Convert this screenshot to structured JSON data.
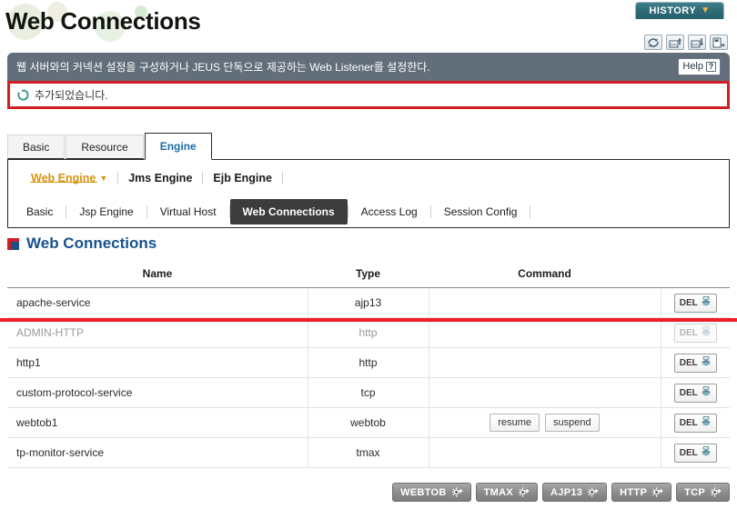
{
  "page": {
    "title": "Web Connections"
  },
  "history_tab": {
    "label": "HISTORY",
    "caret": "chevron-down"
  },
  "top_tools": [
    {
      "name": "refresh-icon",
      "title": "Refresh"
    },
    {
      "name": "xml-upload-icon",
      "title": "XML Upload"
    },
    {
      "name": "xml-download-icon",
      "title": "XML Download"
    },
    {
      "name": "apply-icon",
      "title": "Apply"
    }
  ],
  "banner": {
    "description": "웹 서버와의 커넥션 설정을 구성하거나 JEUS 단독으로 제공하는 Web Listener를 설정한다.",
    "help_label": "Help",
    "help_glyph": "?"
  },
  "message": {
    "text": "추가되었습니다.",
    "icon": "refresh-circle-icon",
    "border_color": "#cf1f24"
  },
  "tabs_level1": [
    {
      "label": "Basic",
      "active": false
    },
    {
      "label": "Resource",
      "active": false
    },
    {
      "label": "Engine",
      "active": true
    }
  ],
  "subnav": [
    {
      "label": "Web Engine",
      "active": true,
      "has_caret": true
    },
    {
      "label": "Jms Engine",
      "active": false,
      "has_caret": false
    },
    {
      "label": "Ejb Engine",
      "active": false,
      "has_caret": false
    }
  ],
  "tabs_level3": [
    {
      "label": "Basic",
      "active": false
    },
    {
      "label": "Jsp Engine",
      "active": false
    },
    {
      "label": "Virtual Host",
      "active": false
    },
    {
      "label": "Web Connections",
      "active": true
    },
    {
      "label": "Access Log",
      "active": false
    },
    {
      "label": "Session Config",
      "active": false
    }
  ],
  "section": {
    "title": "Web Connections"
  },
  "table": {
    "columns": [
      "Name",
      "Type",
      "Command"
    ],
    "action_label": "DEL",
    "rows": [
      {
        "name": "apache-service",
        "type": "ajp13",
        "commands": [],
        "del_enabled": true,
        "disabled": false,
        "highlighted": true
      },
      {
        "name": "ADMIN-HTTP",
        "type": "http",
        "commands": [],
        "del_enabled": false,
        "disabled": true,
        "highlighted": false
      },
      {
        "name": "http1",
        "type": "http",
        "commands": [],
        "del_enabled": true,
        "disabled": false,
        "highlighted": false
      },
      {
        "name": "custom-protocol-service",
        "type": "tcp",
        "commands": [],
        "del_enabled": true,
        "disabled": false,
        "highlighted": false
      },
      {
        "name": "webtob1",
        "type": "webtob",
        "commands": [
          "resume",
          "suspend"
        ],
        "del_enabled": true,
        "disabled": false,
        "highlighted": false
      },
      {
        "name": "tp-monitor-service",
        "type": "tmax",
        "commands": [],
        "del_enabled": true,
        "disabled": false,
        "highlighted": false
      }
    ]
  },
  "bottom_buttons": [
    {
      "label": "WEBTOB"
    },
    {
      "label": "TMAX"
    },
    {
      "label": "AJP13"
    },
    {
      "label": "HTTP"
    },
    {
      "label": "TCP"
    }
  ],
  "colors": {
    "accent_red": "#cf1f24",
    "highlight_red": "#ee1c24",
    "banner_bg": "#626e79",
    "section_blue": "#17528f",
    "subnav_active": "#d99412",
    "tab_active_blue": "#1a6ea8",
    "tab3_active_bg": "#3c3c3c",
    "history_teal": "#2f6a76"
  }
}
